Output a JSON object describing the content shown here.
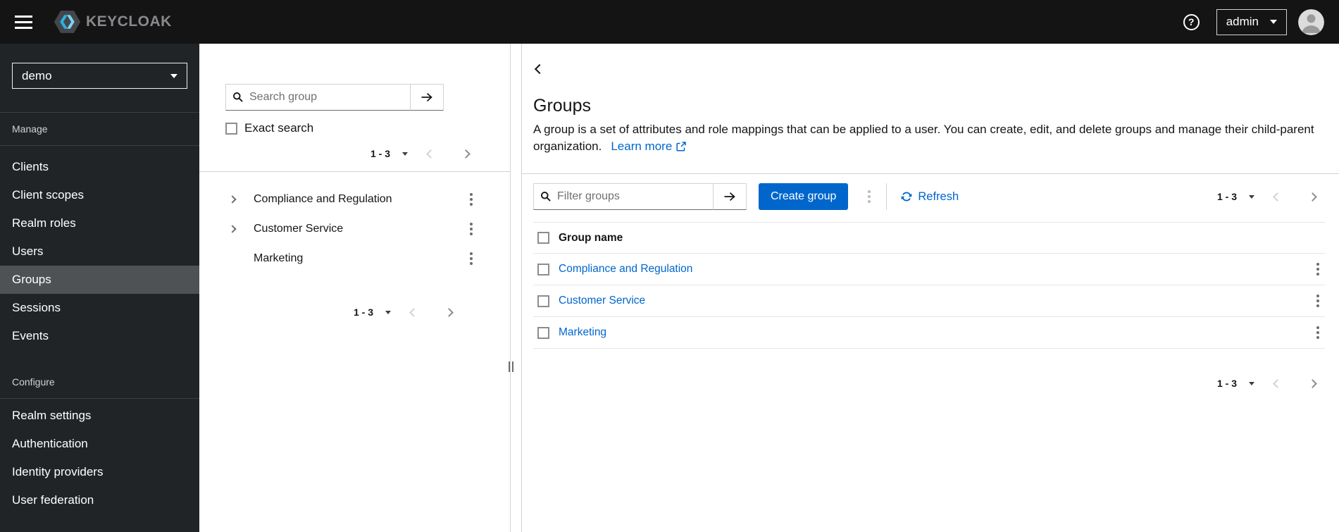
{
  "header": {
    "brand": "KEYCLOAK",
    "user": "admin"
  },
  "icons": {
    "help_glyph": "?",
    "menu": "hamburger",
    "search": "magnifier",
    "arrow_right": "arrow-right",
    "caret": "caret-down",
    "kebab": "kebab-vertical",
    "refresh": "sync",
    "external_link": "external-link",
    "back": "angle-left",
    "expand": "angle-right",
    "avatar": "user-circle"
  },
  "sidebar": {
    "realm": "demo",
    "selected": "Groups",
    "manage_label": "Manage",
    "manage_items": [
      "Clients",
      "Client scopes",
      "Realm roles",
      "Users",
      "Groups",
      "Sessions",
      "Events"
    ],
    "configure_label": "Configure",
    "configure_items": [
      "Realm settings",
      "Authentication",
      "Identity providers",
      "User federation"
    ]
  },
  "tree_panel": {
    "search_placeholder": "Search group",
    "exact_search": "Exact search",
    "pagination_range": "1 - 3",
    "items": [
      {
        "name": "Compliance and Regulation",
        "expandable": true
      },
      {
        "name": "Customer Service",
        "expandable": true
      },
      {
        "name": "Marketing",
        "expandable": false
      }
    ]
  },
  "main": {
    "title": "Groups",
    "description": "A group is a set of attributes and role mappings that can be applied to a user. You can create, edit, and delete groups and manage their child-parent organization.",
    "learn_more": "Learn more",
    "filter_placeholder": "Filter groups",
    "create_button": "Create group",
    "refresh": "Refresh",
    "pagination_range": "1 - 3",
    "table_header": "Group name",
    "rows": [
      {
        "name": "Compliance and Regulation"
      },
      {
        "name": "Customer Service"
      },
      {
        "name": "Marketing"
      }
    ]
  },
  "colors": {
    "accent": "#0066cc",
    "link": "#0066cc",
    "header_bg": "#141414",
    "sidebar_bg": "#212427",
    "sidebar_selected_bg": "#4f5255",
    "border": "#d2d2d2"
  }
}
